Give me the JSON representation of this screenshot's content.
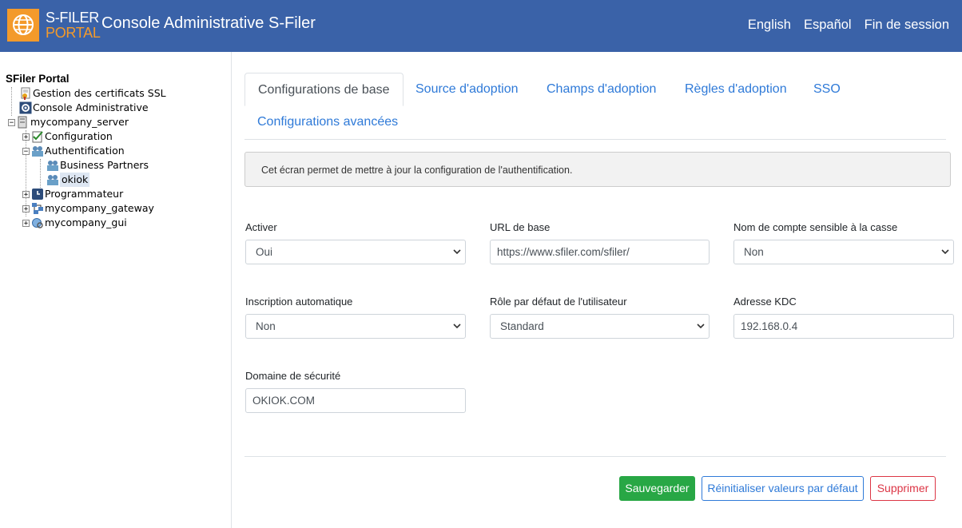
{
  "header": {
    "logo_line1": "S-FILER",
    "logo_line2": "PORTAL",
    "title": "Console Administrative S-Filer",
    "links": [
      "English",
      "Español",
      "Fin de session"
    ]
  },
  "tree": {
    "root": "SFiler Portal",
    "nodes": {
      "ssl": "Gestion des certificats SSL",
      "console": "Console Administrative",
      "server": "mycompany_server",
      "configuration": "Configuration",
      "auth": "Authentification",
      "bp": "Business Partners",
      "okiok": "okiok",
      "programmateur": "Programmateur",
      "gateway": "mycompany_gateway",
      "gui": "mycompany_gui"
    }
  },
  "tabs": [
    "Configurations de base",
    "Source d'adoption",
    "Champs d'adoption",
    "Règles d'adoption",
    "SSO",
    "Configurations avancées"
  ],
  "info_text": "Cet écran permet de mettre à jour la configuration de l'authentification.",
  "form": {
    "activer": {
      "label": "Activer",
      "value": "Oui"
    },
    "url": {
      "label": "URL de base",
      "value": "https://www.sfiler.com/sfiler/"
    },
    "case": {
      "label": "Nom de compte sensible à la casse",
      "value": "Non"
    },
    "inscription": {
      "label": "Inscription automatique",
      "value": "Non"
    },
    "role": {
      "label": "Rôle par défaut de l'utilisateur",
      "value": "Standard"
    },
    "kdc": {
      "label": "Adresse KDC",
      "value": "192.168.0.4"
    },
    "domaine": {
      "label": "Domaine de sécurité",
      "value": "OKIOK.COM"
    }
  },
  "buttons": {
    "save": "Sauvegarder",
    "reset": "Réinitialiser valeurs par défaut",
    "delete": "Supprimer"
  },
  "colors": {
    "header": "#3a62a8",
    "accent": "#f39a2b",
    "link": "#2f7ad8",
    "success": "#28a745",
    "danger": "#dc3545"
  }
}
